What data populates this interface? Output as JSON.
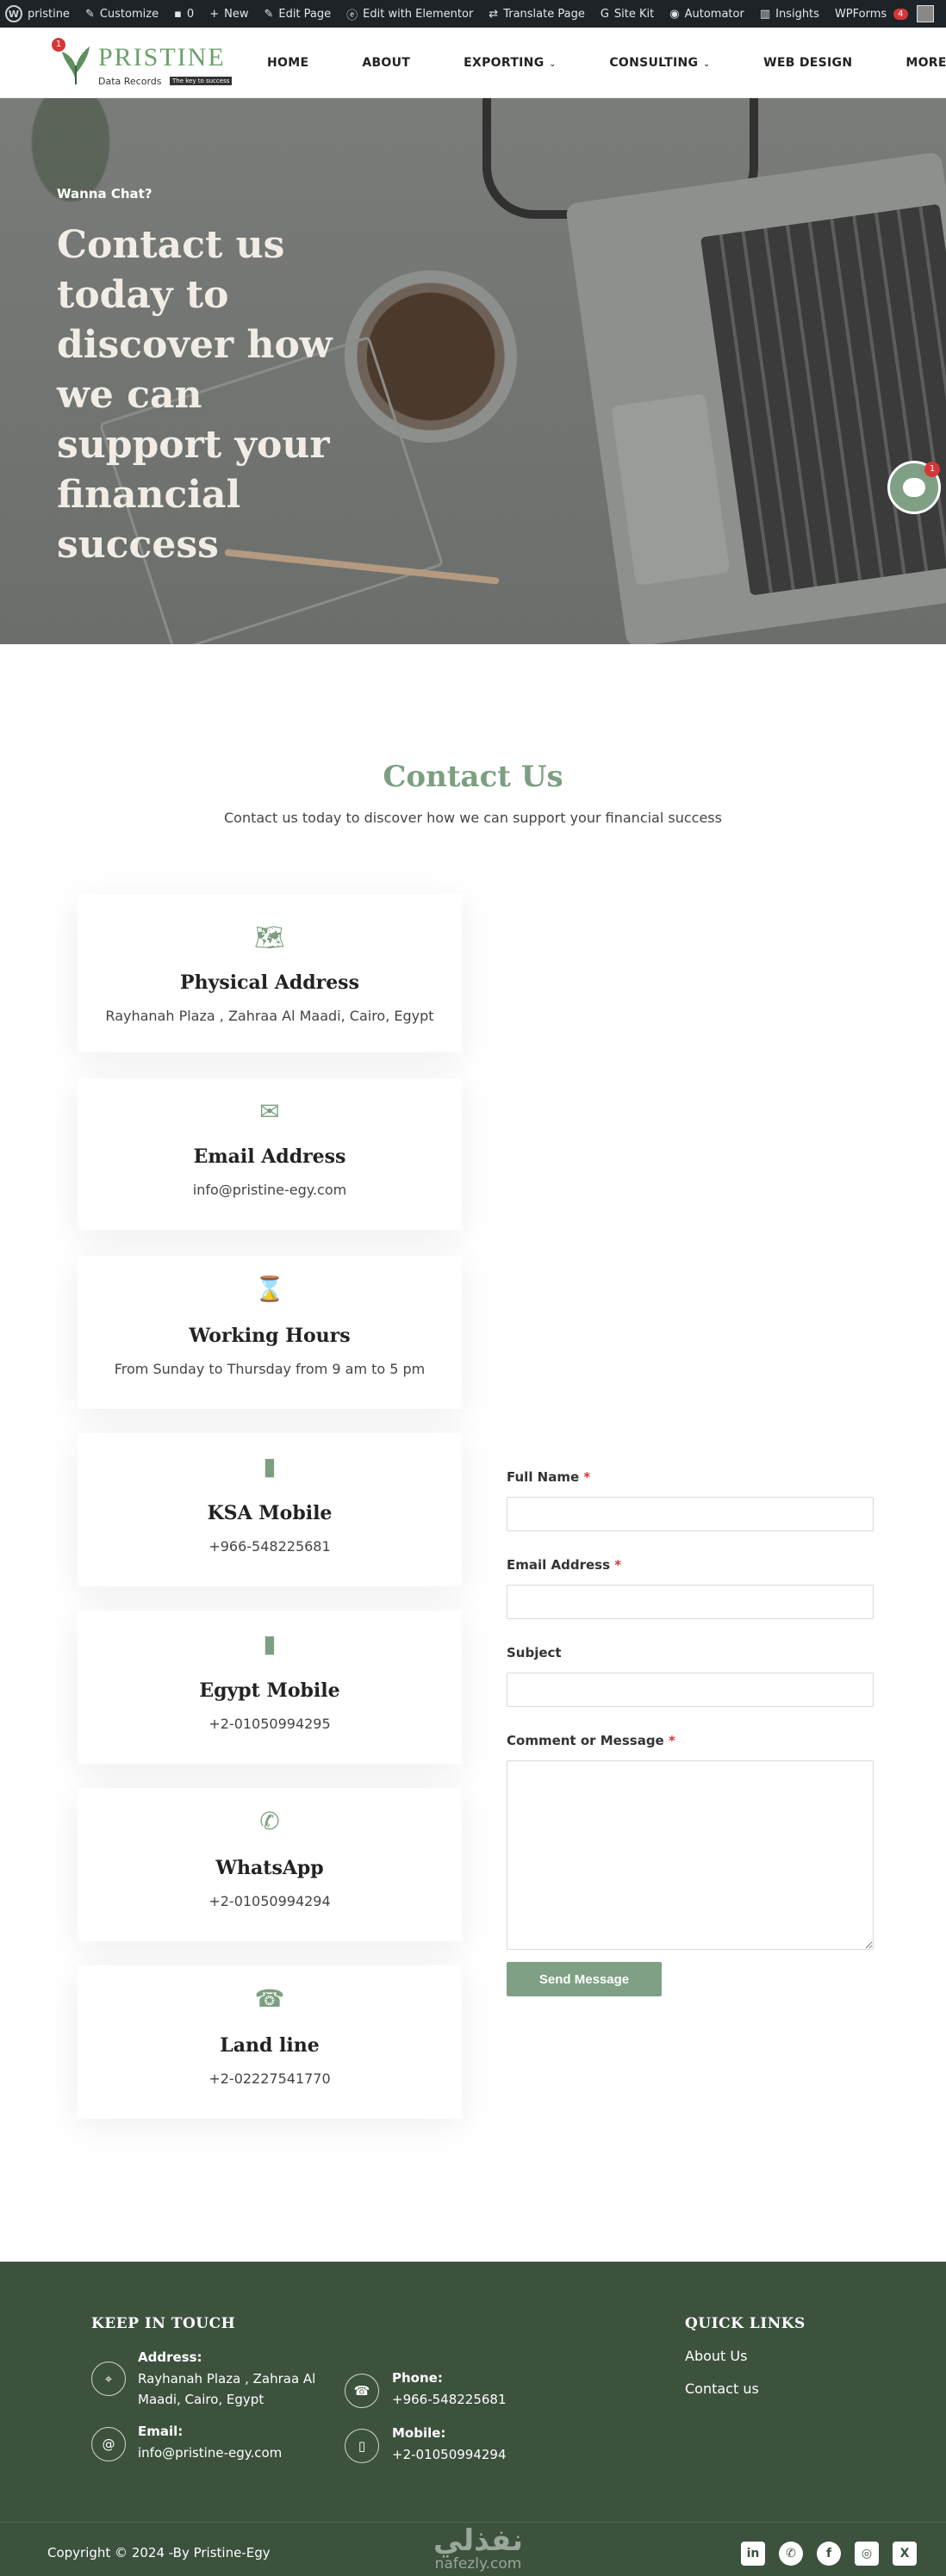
{
  "adminbar": {
    "items": [
      {
        "icon": "wordpress-icon",
        "label": "pristine"
      },
      {
        "icon": "customize-icon",
        "label": "Customize"
      },
      {
        "icon": "comment-icon",
        "label": "0"
      },
      {
        "icon": "plus-icon",
        "label": "New"
      },
      {
        "icon": "pencil-icon",
        "label": "Edit Page"
      },
      {
        "icon": "elementor-icon",
        "label": "Edit with Elementor"
      },
      {
        "icon": "translate-icon",
        "label": "Translate Page"
      },
      {
        "icon": "sitekit-icon",
        "label": "Site Kit"
      },
      {
        "icon": "automator-icon",
        "label": "Automator"
      },
      {
        "icon": "chart-icon",
        "label": "Insights"
      },
      {
        "icon": "",
        "label": "WPForms"
      }
    ],
    "wpforms_badge": "4"
  },
  "header": {
    "logo_name": "PRISTINE",
    "logo_sub": "Data Records",
    "logo_tag": "The key to success",
    "logo_badge": "1",
    "nav": [
      {
        "label": "HOME",
        "dropdown": false
      },
      {
        "label": "ABOUT",
        "dropdown": false
      },
      {
        "label": "EXPORTING",
        "dropdown": true
      },
      {
        "label": "CONSULTING",
        "dropdown": true
      },
      {
        "label": "WEB DESIGN",
        "dropdown": false
      },
      {
        "label": "MORE",
        "dropdown": true
      }
    ]
  },
  "hero": {
    "kicker": "Wanna Chat?",
    "title": "Contact us today to discover how we can support your financial success"
  },
  "chat": {
    "badge": "1"
  },
  "contact": {
    "title": "Contact Us",
    "subtitle": "Contact us today to discover how we can support your financial success",
    "cards": [
      {
        "icon": "map-icon",
        "glyph": "🗺",
        "title": "Physical Address",
        "value": "Rayhanah Plaza , Zahraa Al Maadi, Cairo, Egypt"
      },
      {
        "icon": "envelope-icon",
        "glyph": "✉",
        "title": "Email Address",
        "value": "info@pristine-egy.com"
      },
      {
        "icon": "hourglass-icon",
        "glyph": "⌛",
        "title": "Working Hours",
        "value": "From Sunday to Thursday from 9 am to 5 pm"
      },
      {
        "icon": "mobile-icon",
        "glyph": "▮",
        "title": "KSA Mobile",
        "value": "+966-548225681"
      },
      {
        "icon": "mobile-icon",
        "glyph": "▮",
        "title": "Egypt Mobile",
        "value": "+2-01050994295"
      },
      {
        "icon": "whatsapp-icon",
        "glyph": "✆",
        "title": "WhatsApp",
        "value": "+2-01050994294"
      },
      {
        "icon": "phone-icon",
        "glyph": "☎",
        "title": "Land line",
        "value": "+2-02227541770"
      }
    ]
  },
  "form": {
    "full_name_label": "Full Name",
    "email_label": "Email Address",
    "subject_label": "Subject",
    "message_label": "Comment or Message",
    "required_mark": "*",
    "submit_label": "Send Message"
  },
  "footer": {
    "keep_in_touch": "KEEP IN TOUCH",
    "address_label": "Address:",
    "address_value": "Rayhanah Plaza , Zahraa Al Maadi, Cairo, Egypt",
    "email_label": "Email:",
    "email_value": "info@pristine-egy.com",
    "phone_label": "Phone:",
    "phone_value": "+966-548225681",
    "mobile_label": "Mobile:",
    "mobile_value": "+2-01050994294",
    "quick_links": "QUICK LINKS",
    "links": [
      "About Us",
      "Contact us"
    ],
    "copyright": "Copyright © 2024 -By Pristine-Egy",
    "watermark_ar": "نفذلي",
    "watermark_lat": "nafezly.com",
    "socials": [
      {
        "icon": "linkedin-icon",
        "glyph": "in"
      },
      {
        "icon": "whatsapp-icon",
        "glyph": "✆"
      },
      {
        "icon": "facebook-icon",
        "glyph": "f"
      },
      {
        "icon": "instagram-icon",
        "glyph": "◎"
      },
      {
        "icon": "x-icon",
        "glyph": "X"
      }
    ]
  }
}
